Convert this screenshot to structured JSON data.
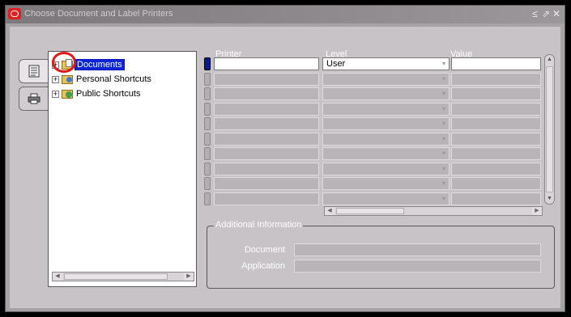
{
  "window": {
    "title": "Choose Document and Label Printers",
    "controls": [
      "≤",
      "⇗",
      "✕"
    ]
  },
  "tabs": [
    {
      "name": "documents-tab",
      "icon": "document-list-icon"
    },
    {
      "name": "printer-tab",
      "icon": "printer-icon"
    }
  ],
  "tree": {
    "expander": "+",
    "items": [
      {
        "label": "Documents",
        "icon": "documents-folder-icon",
        "selected": true
      },
      {
        "label": "Personal Shortcuts",
        "icon": "personal-folder-icon"
      },
      {
        "label": "Public Shortcuts",
        "icon": "public-folder-icon"
      }
    ]
  },
  "grid": {
    "headers": {
      "printer": "Printer",
      "level": "Level",
      "value": "Value"
    },
    "rows": [
      {
        "printer": "",
        "level": "User",
        "value": ""
      },
      {
        "printer": "",
        "level": "",
        "value": ""
      },
      {
        "printer": "",
        "level": "",
        "value": ""
      },
      {
        "printer": "",
        "level": "",
        "value": ""
      },
      {
        "printer": "",
        "level": "",
        "value": ""
      },
      {
        "printer": "",
        "level": "",
        "value": ""
      },
      {
        "printer": "",
        "level": "",
        "value": ""
      },
      {
        "printer": "",
        "level": "",
        "value": ""
      },
      {
        "printer": "",
        "level": "",
        "value": ""
      },
      {
        "printer": "",
        "level": "",
        "value": ""
      }
    ]
  },
  "additional_info": {
    "legend": "Additional Information",
    "document_label": "Document",
    "document_value": "",
    "application_label": "Application",
    "application_value": ""
  },
  "colors": {
    "selection": "#0a24d6",
    "callout": "#e01818",
    "current_row_indicator": "#0a1a8c"
  }
}
